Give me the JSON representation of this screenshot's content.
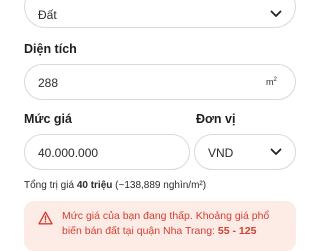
{
  "property_type": {
    "value": "Đất"
  },
  "area": {
    "label": "Diện tích",
    "value": "288",
    "unit_base": "m",
    "unit_exp": "2"
  },
  "price": {
    "label": "Mức giá",
    "value": "40.000.000"
  },
  "currency": {
    "label": "Đơn vị",
    "value": "VND"
  },
  "total": {
    "prefix": "Tổng trị giá ",
    "amount": "40 triệu",
    "per_unit": " (~138,889 nghìn/m²)"
  },
  "warning": {
    "text_normal": "Mức giá của bạn đang thấp. Khoảng giá phổ biến bán đất tại quận Nha Trang: ",
    "text_range": "55 - 125"
  },
  "colors": {
    "warning_text": "#d23f31",
    "warning_bg": "#fdebe6",
    "border": "#d9d9d9"
  }
}
